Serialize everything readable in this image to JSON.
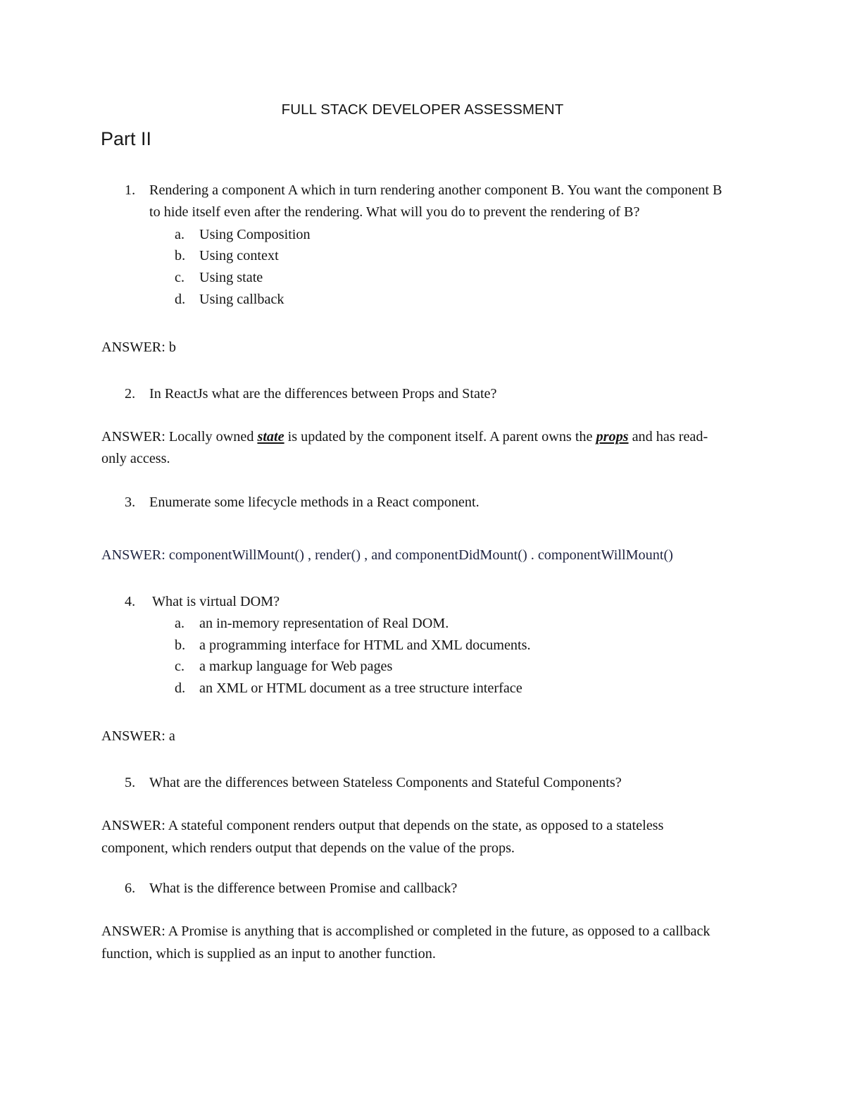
{
  "document": {
    "title": "FULL STACK DEVELOPER ASSESSMENT",
    "part_heading": "Part II"
  },
  "questions": [
    {
      "marker": "1.",
      "text": "Rendering a component A which in turn rendering another component B. You want the component B to hide itself even after the rendering. What will you do to prevent the rendering of B?",
      "choices": [
        {
          "marker": "a.",
          "text": "Using Composition"
        },
        {
          "marker": "b.",
          "text": "Using context"
        },
        {
          "marker": "c.",
          "text": "Using state"
        },
        {
          "marker": "d.",
          "text": "Using callback"
        }
      ],
      "answer": "ANSWER: b"
    },
    {
      "marker": "2.",
      "text": "In ReactJs what are the differences between Props and State?",
      "answer_prefix": "ANSWER: Locally owned ",
      "answer_kw1": "state",
      "answer_mid": " is updated by the component itself. A parent owns the ",
      "answer_kw2": "props",
      "answer_suffix": " and has read-only access."
    },
    {
      "marker": "3.",
      "text": "Enumerate some lifecycle methods in a React component.",
      "answer": "ANSWER:  componentWillMount() , render() , and componentDidMount() . componentWillMount()"
    },
    {
      "marker": "4.",
      "text": "What is virtual DOM?",
      "choices": [
        {
          "marker": "a.",
          "text": "an in-memory representation of Real DOM."
        },
        {
          "marker": "b.",
          "text": "a programming interface for HTML and XML documents."
        },
        {
          "marker": "c.",
          "text": "a markup language for Web pages"
        },
        {
          "marker": "d.",
          "text": "an XML or HTML document as a tree structure interface"
        }
      ],
      "answer": "ANSWER: a"
    },
    {
      "marker": "5.",
      "text": "What are the differences between Stateless Components and Stateful Components?",
      "answer": "ANSWER: A stateful component renders output that depends on the state, as opposed to a stateless component, which renders output that depends on the value of the props."
    },
    {
      "marker": "6.",
      "text": "What is the difference between Promise and callback?",
      "answer": "ANSWER: A Promise is anything that is accomplished or completed in the future, as opposed to a callback function, which is supplied as an input to another function."
    }
  ],
  "colors": {
    "page_background": "#ffffff",
    "body_text": "#141414",
    "navy_text": "#1f2440"
  }
}
